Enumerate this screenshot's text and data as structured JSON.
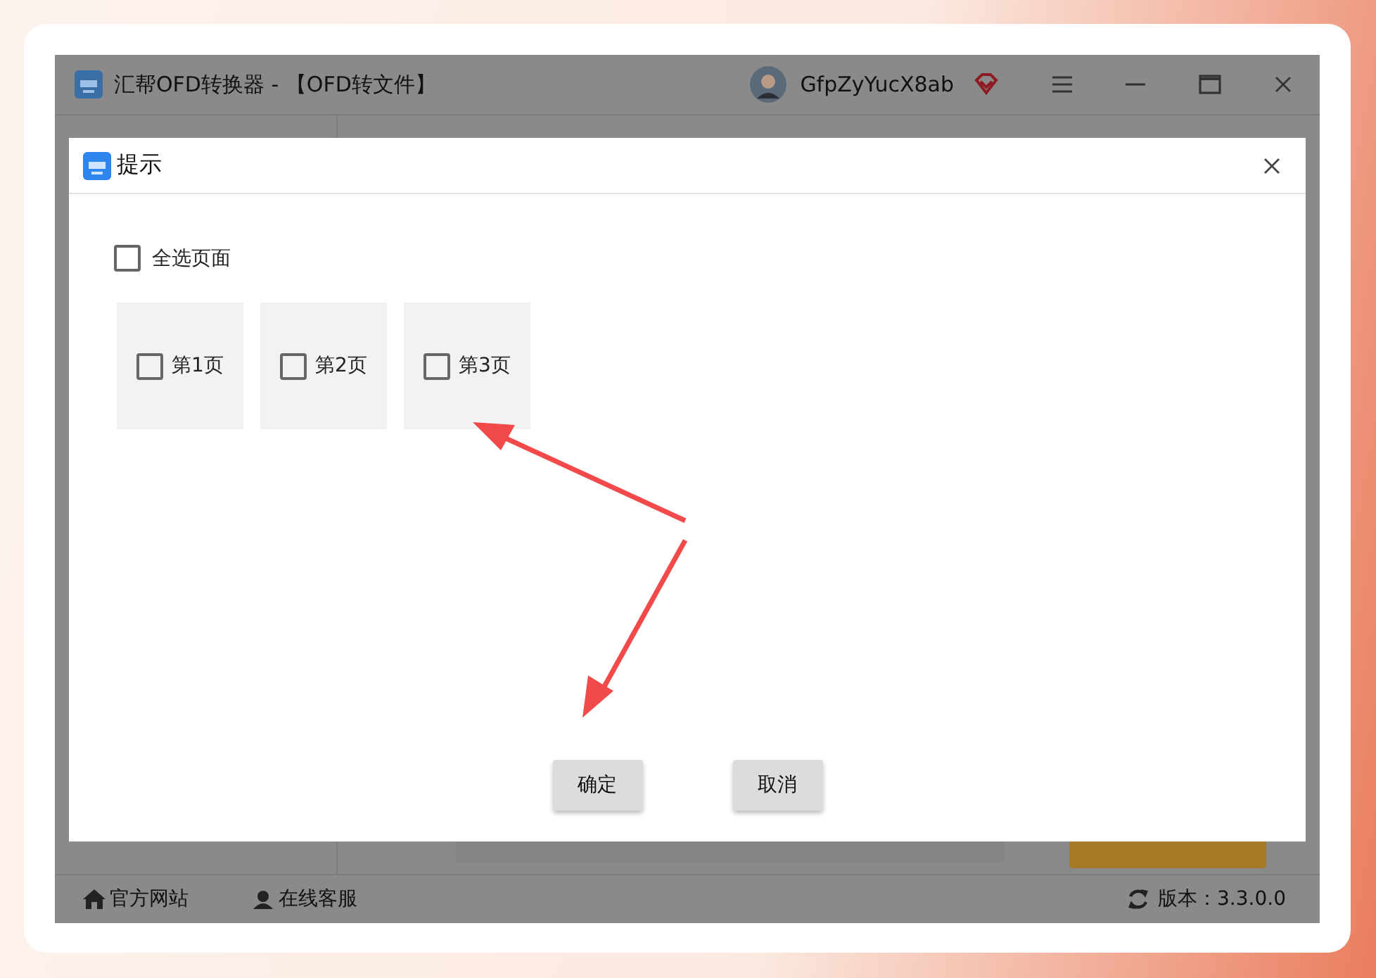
{
  "window": {
    "title": "汇帮OFD转换器 - 【OFD转文件】",
    "user": "GfpZyYucX8ab"
  },
  "dialog": {
    "title": "提示",
    "select_all": {
      "label": "全选页面",
      "checked": false
    },
    "pages": [
      {
        "label": "第1页",
        "checked": false
      },
      {
        "label": "第2页",
        "checked": false
      },
      {
        "label": "第3页",
        "checked": false
      }
    ],
    "buttons": [
      "确定",
      "取消"
    ]
  },
  "status_bar": {
    "links": [
      "官方网站",
      "在线客服"
    ],
    "version": "版本：3.3.0.0"
  }
}
